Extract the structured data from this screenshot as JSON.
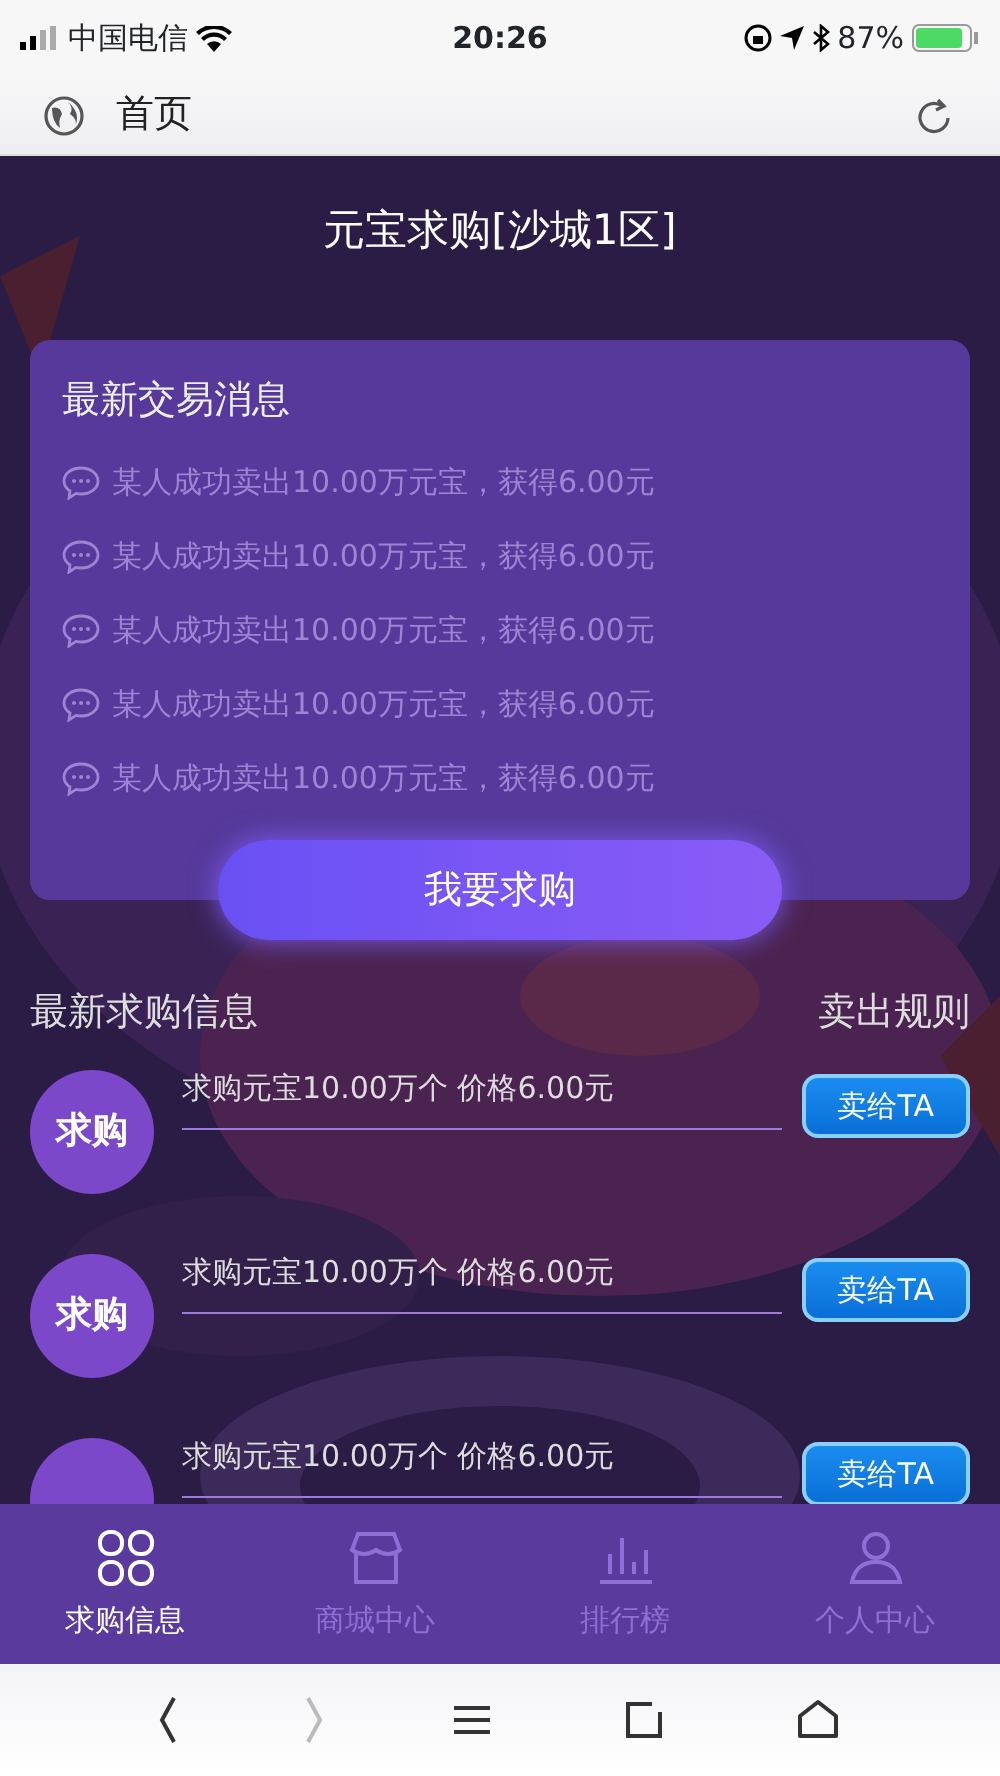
{
  "status_bar": {
    "carrier": "中国电信",
    "time": "20:26",
    "battery": "87%"
  },
  "browser": {
    "title": "首页"
  },
  "page_title": "元宝求购[沙城1区]",
  "news": {
    "title": "最新交易消息",
    "items": [
      "某人成功卖出10.00万元宝，获得6.00元",
      "某人成功卖出10.00万元宝，获得6.00元",
      "某人成功卖出10.00万元宝，获得6.00元",
      "某人成功卖出10.00万元宝，获得6.00元",
      "某人成功卖出10.00万元宝，获得6.00元"
    ]
  },
  "buy_button": "我要求购",
  "requests": {
    "title": "最新求购信息",
    "rules_link": "卖出规则",
    "items": [
      {
        "badge": "求购",
        "text": "求购元宝10.00万个 价格6.00元",
        "button": "卖给TA"
      },
      {
        "badge": "求购",
        "text": "求购元宝10.00万个 价格6.00元",
        "button": "卖给TA"
      },
      {
        "text": "求购元宝10.00万个 价格6.00元",
        "button": "卖给TA"
      }
    ]
  },
  "tabs": [
    {
      "kind": "grid",
      "label": "求购信息",
      "selected": true
    },
    {
      "kind": "shop",
      "label": "商城中心",
      "selected": false
    },
    {
      "kind": "chart",
      "label": "排行榜",
      "selected": false
    },
    {
      "kind": "person",
      "label": "个人中心",
      "selected": false
    }
  ],
  "toolbar": [
    {
      "kind": "back",
      "disabled": false
    },
    {
      "kind": "forward",
      "disabled": true
    },
    {
      "kind": "menu",
      "disabled": false
    },
    {
      "kind": "tabs",
      "disabled": false
    },
    {
      "kind": "home",
      "disabled": false
    }
  ]
}
